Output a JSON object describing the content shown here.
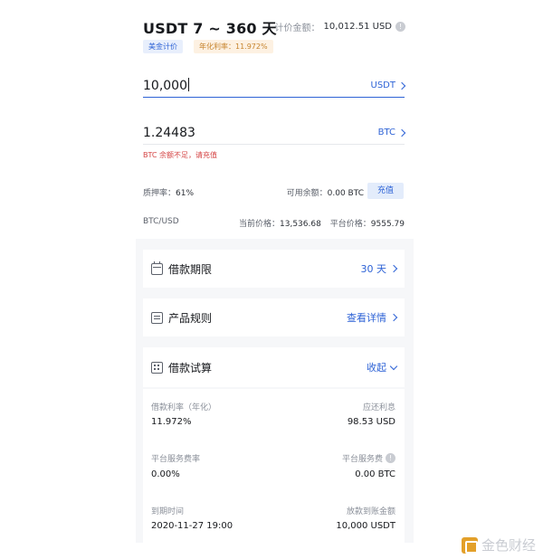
{
  "header": {
    "title": "USDT 7 ~ 360 天",
    "pricing_label": "计价金额：",
    "pricing_value": "10,012.51 USD",
    "info_icon": "info-icon"
  },
  "tags": {
    "usd_pricing": "美金计价",
    "annual_rate": "年化利率：11.972%"
  },
  "loan_input": {
    "value": "10,000",
    "unit": "USDT"
  },
  "collateral_input": {
    "value": "1.24483",
    "unit": "BTC",
    "warning": "BTC 余额不足，请充值"
  },
  "meta": {
    "pledge_rate_label": "质押率：",
    "pledge_rate_value": "61%",
    "available_label": "可用余额：",
    "available_value": "0.00 BTC",
    "recharge_button": "充值",
    "pair": "BTC/USD",
    "current_price_label": "当前价格：",
    "current_price_value": "13,536.68",
    "platform_price_label": "平台价格：",
    "platform_price_value": "9555.79"
  },
  "cards": {
    "term": {
      "label": "借款期限",
      "value": "30 天"
    },
    "rules": {
      "label": "产品规则",
      "value": "查看详情"
    },
    "trial": {
      "label": "借款试算",
      "value": "收起"
    }
  },
  "details": {
    "rate_label": "借款利率（年化）",
    "rate_value": "11.972%",
    "interest_label": "应还利息",
    "interest_value": "98.53 USD",
    "fee_rate_label": "平台服务费率",
    "fee_rate_value": "0.00%",
    "fee_label": "平台服务费",
    "fee_value": "0.00 BTC",
    "due_label": "到期时间",
    "due_value": "2020-11-27 19:00",
    "payout_label": "放款到账金额",
    "payout_value": "10,000 USDT"
  },
  "watermark": {
    "text": "金色财经"
  },
  "colors": {
    "accent": "#2e63d6",
    "warning": "#d44343",
    "rate_tag": "#c7852f"
  }
}
